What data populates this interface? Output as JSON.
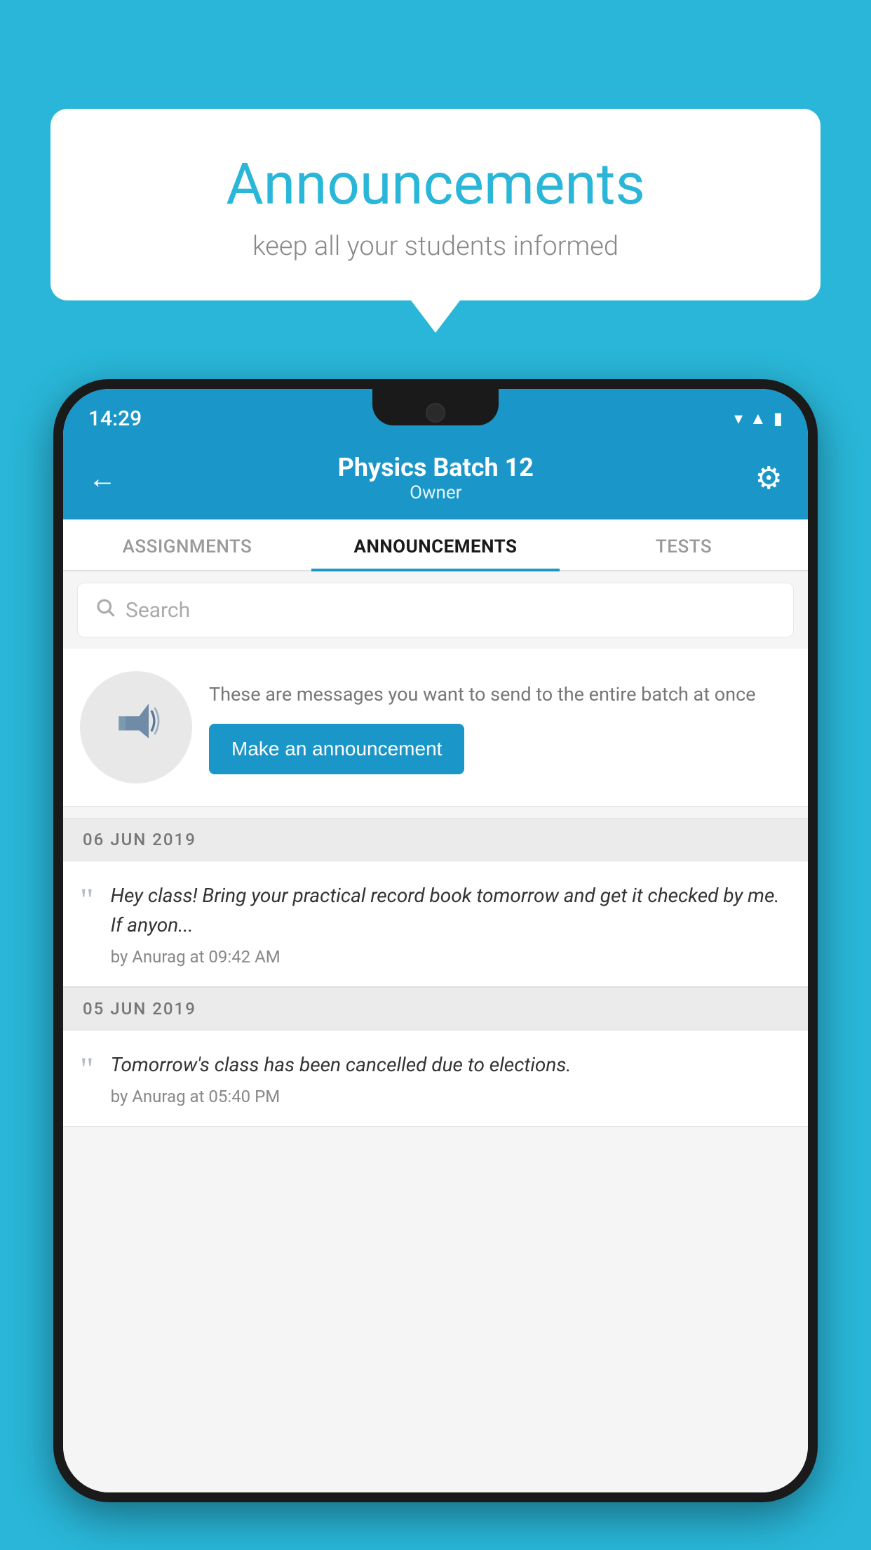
{
  "background_color": "#29B6D8",
  "bubble": {
    "title": "Announcements",
    "subtitle": "keep all your students informed"
  },
  "status_bar": {
    "time": "14:29",
    "icons": [
      "wifi",
      "signal",
      "battery"
    ]
  },
  "header": {
    "title": "Physics Batch 12",
    "subtitle": "Owner",
    "back_label": "←",
    "gear_label": "⚙"
  },
  "tabs": [
    {
      "label": "ASSIGNMENTS",
      "active": false
    },
    {
      "label": "ANNOUNCEMENTS",
      "active": true
    },
    {
      "label": "TESTS",
      "active": false
    }
  ],
  "search": {
    "placeholder": "Search"
  },
  "promo": {
    "description": "These are messages you want to send to the entire batch at once",
    "button_label": "Make an announcement"
  },
  "announcements": [
    {
      "date": "06  JUN  2019",
      "text": "Hey class! Bring your practical record book tomorrow and get it checked by me. If anyon...",
      "meta": "by Anurag at 09:42 AM"
    },
    {
      "date": "05  JUN  2019",
      "text": "Tomorrow's class has been cancelled due to elections.",
      "meta": "by Anurag at 05:40 PM"
    }
  ]
}
